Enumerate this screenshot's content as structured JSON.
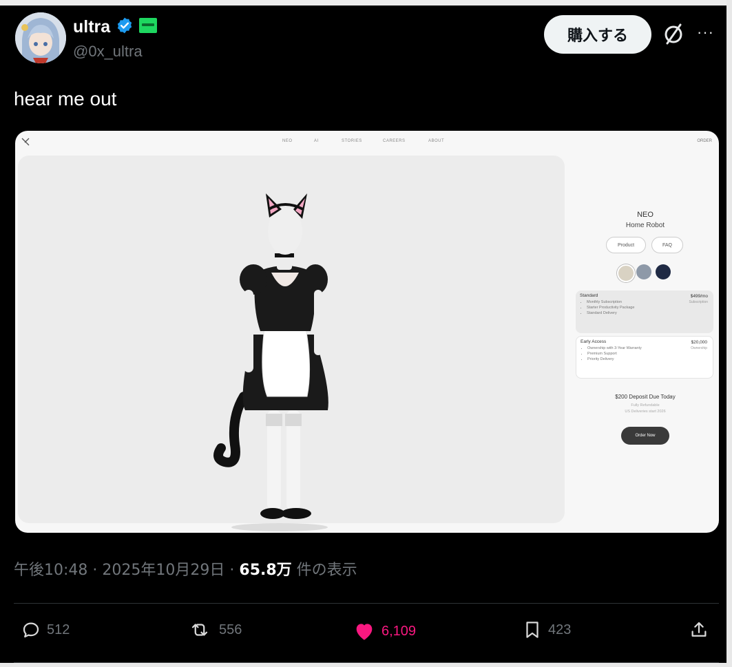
{
  "author": {
    "display_name": "ultra",
    "handle": "@0x_ultra",
    "verified_icon": "verified-badge-icon",
    "affiliate_badge_color": "#1db954"
  },
  "header": {
    "buy_label": "購入する",
    "grok_icon": "grok-icon",
    "more_icon": "more-icon",
    "more_label": "···"
  },
  "tweet": {
    "text": "hear me out"
  },
  "media": {
    "nav": [
      "NEO",
      "AI",
      "STORIES",
      "CAREERS",
      "ABOUT"
    ],
    "order_top": "ORDER",
    "product": {
      "title": "NEO",
      "subtitle": "Home Robot",
      "tabs": [
        "Product",
        "FAQ"
      ],
      "swatches": [
        "#d9d2c3",
        "#8e99a8",
        "#1f2a44"
      ],
      "plans": [
        {
          "name": "Standard",
          "price": "$499/mo",
          "price_sub": "Subscription",
          "features": [
            "Monthly Subscription",
            "Starter Productivity Package",
            "Standard Delivery"
          ]
        },
        {
          "name": "Early Access",
          "price": "$20,000",
          "price_sub": "Ownership",
          "features": [
            "Ownership with 3-Year Warranty",
            "Premium Support",
            "Priority Delivery"
          ]
        }
      ],
      "deposit": "$200 Deposit Due Today",
      "deposit_note_1": "Fully Refundable",
      "deposit_note_2": "US Deliveries start 2026",
      "order_button": "Order Now"
    }
  },
  "meta": {
    "time": "午後10:48",
    "sep": "·",
    "date": "2025年10月29日",
    "views_count": "65.8万",
    "views_label": "件の表示"
  },
  "actions": {
    "replies": "512",
    "reposts": "556",
    "likes": "6,109",
    "bookmarks": "423",
    "like_color": "#f91880"
  }
}
